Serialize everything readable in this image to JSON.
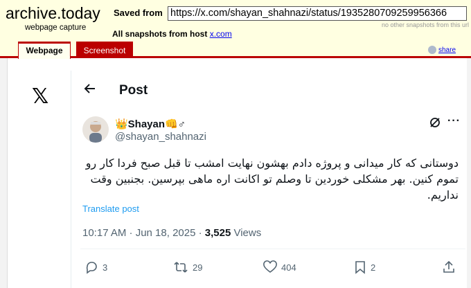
{
  "archive": {
    "title": "archive.today",
    "subtitle": "webpage capture",
    "saved_from_label": "Saved from",
    "url": "https://x.com/shayan_shahnazi/status/1935280709259956366",
    "no_other": "no other snapshots from this url",
    "all_snapshots_label": "All snapshots  from host",
    "host": "x.com",
    "tabs": [
      "Webpage",
      "Screenshot"
    ],
    "share": "share"
  },
  "page": {
    "logo": "𝕏",
    "title": "Post"
  },
  "tweet": {
    "display_name": "👑Shayan👊♂",
    "handle": "@shayan_shahnazi",
    "text": "دوستانی که کار میدانی و پروژه دادم بهشون نهایت امشب تا قبل صبح فردا کار رو تموم کنین. بهر مشکلی خوردین تا وصلم تو اکانت اره ماهی بپرسین. بجنبین وقت نداریم.",
    "translate": "Translate post",
    "time": "10:17 AM · Jun 18, 2025 · ",
    "views_count": "3,525",
    "views_label": " Views",
    "replies": "3",
    "reposts": "29",
    "likes": "404",
    "bookmarks": "2"
  }
}
